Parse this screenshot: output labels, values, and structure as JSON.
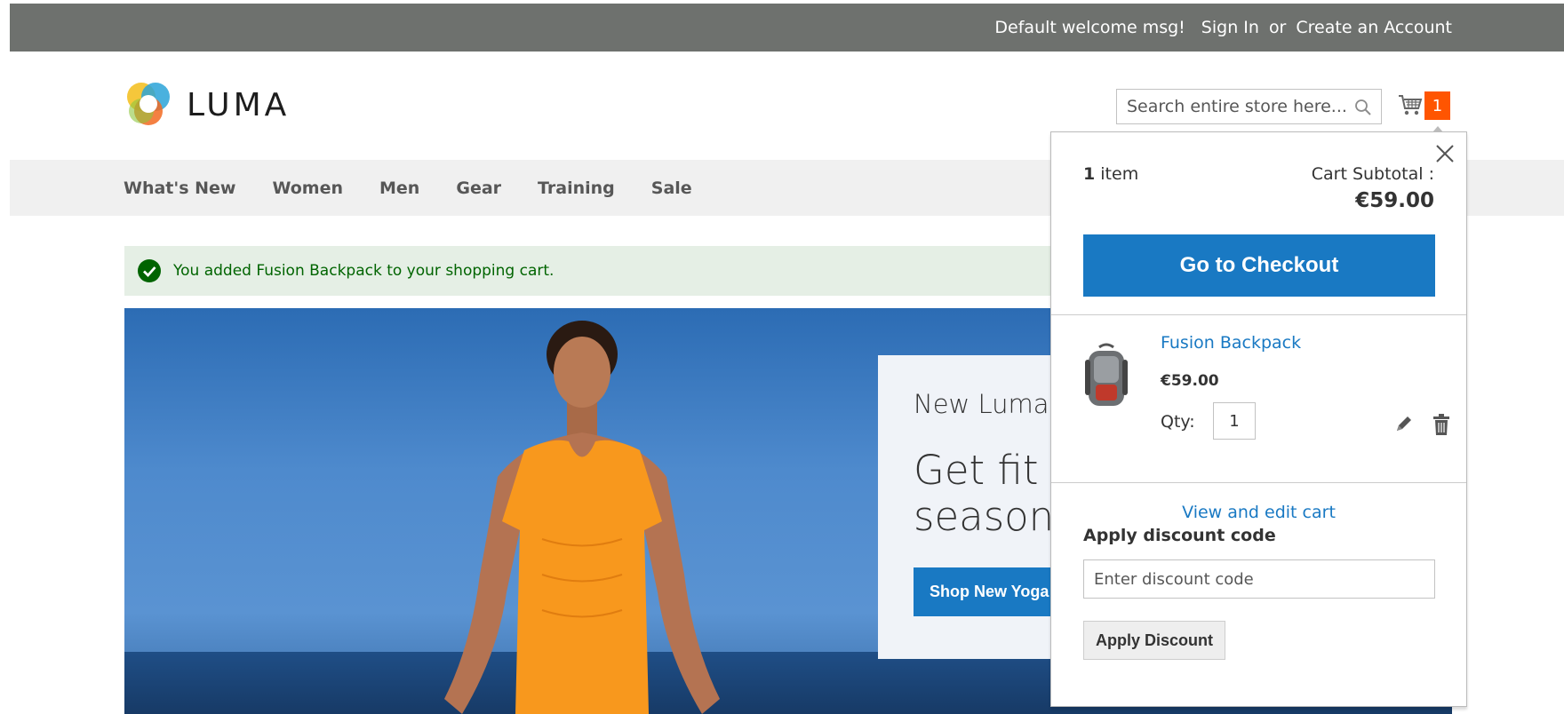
{
  "top_panel": {
    "welcome": "Default welcome msg!",
    "sign_in": "Sign In",
    "or": "or",
    "create_account": "Create an Account"
  },
  "header": {
    "logo_text": "LUMA",
    "search_placeholder": "Search entire store here...",
    "cart_count": "1"
  },
  "nav": {
    "items": [
      "What's New",
      "Women",
      "Men",
      "Gear",
      "Training",
      "Sale"
    ]
  },
  "message": {
    "text": "You added Fusion Backpack to your shopping cart."
  },
  "hero": {
    "subtitle": "New Luma Yoga Collection",
    "headline_line1": "Get fit and look fab in new",
    "headline_line2": "seasonal styles",
    "button": "Shop New Yoga"
  },
  "minicart": {
    "items_count": "1",
    "items_label": "item",
    "subtotal_label": "Cart Subtotal :",
    "subtotal_value": "€59.00",
    "checkout_button": "Go to Checkout",
    "product": {
      "name": "Fusion Backpack",
      "price": "€59.00",
      "qty_label": "Qty:",
      "qty_value": "1"
    },
    "view_edit_cart": "View and edit cart",
    "discount_title": "Apply discount code",
    "discount_placeholder": "Enter discount code",
    "apply_button": "Apply Discount"
  },
  "colors": {
    "top_panel": "#6e716e",
    "primary_blue": "#1979c3",
    "cart_badge": "#ff5501",
    "success_bg": "#e5efe5",
    "success_text": "#006400"
  }
}
